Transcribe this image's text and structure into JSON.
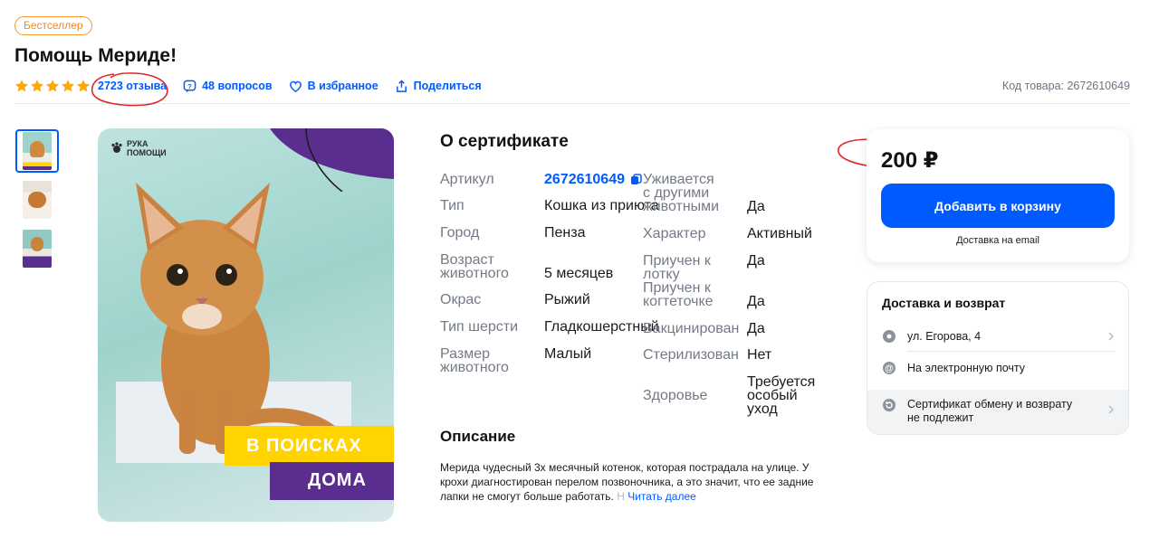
{
  "header": {
    "badge": "Бестселлер",
    "title": "Помощь Мериде!",
    "rating_stars": 5,
    "reviews_link": "2723 отзыва",
    "questions_link": "48 вопросов",
    "favorite_link": "В избранное",
    "share_link": "Поделиться",
    "product_code": "Код товара: 2672610649"
  },
  "gallery": {
    "logo_line1": "РУКА",
    "logo_line2": "ПОМОЩИ",
    "banner_line1": "В ПОИСКАХ",
    "banner_line2": "ДОМА"
  },
  "about": {
    "title": "О сертификате",
    "left": [
      {
        "label": "Артикул",
        "value": "2672610649"
      },
      {
        "label": "Тип",
        "value": "Кошка из приюта"
      },
      {
        "label": "Город",
        "value": "Пенза"
      },
      {
        "label": "Возраст животного",
        "value": "5 месяцев"
      },
      {
        "label": "Окрас",
        "value": "Рыжий"
      },
      {
        "label": "Тип шерсти",
        "value": "Гладкошерстный"
      },
      {
        "label": "Размер животного",
        "value": "Малый"
      }
    ],
    "right": [
      {
        "label": "Уживается с другими животными",
        "value": "Да"
      },
      {
        "label": "Характер",
        "value": "Активный"
      },
      {
        "label": "Приучен к лотку",
        "value": "Да"
      },
      {
        "label": "Приучен к когтеточке",
        "value": "Да"
      },
      {
        "label": "Вакцинирован",
        "value": "Да"
      },
      {
        "label": "Стерилизован",
        "value": "Нет"
      },
      {
        "label": "Здоровье",
        "value": "Требуется особый уход"
      }
    ]
  },
  "description": {
    "title": "Описание",
    "text": "Мерида чудесный 3х месячный котенок, которая пострадала на улице. У крохи диагностирован перелом позвоночника, а это значит, что ее задние лапки не смогут больше работать.",
    "fade_tail": " Н",
    "read_more": "Читать далее"
  },
  "purchase": {
    "price": "200 ₽",
    "add_to_cart": "Добавить в корзину",
    "delivery_note": "Доставка на email"
  },
  "delivery": {
    "title": "Доставка и возврат",
    "address": "ул. Егорова, 4",
    "email_delivery": "На электронную почту",
    "return_line1": "Сертификат обмену и возврату",
    "return_line2": "не подлежит"
  },
  "colors": {
    "accent": "#005bff",
    "badge": "#f08a1c",
    "star": "#ffa800",
    "annotation": "#e3262b",
    "banner_yellow": "#ffd400",
    "banner_purple": "#5a2e8f"
  }
}
